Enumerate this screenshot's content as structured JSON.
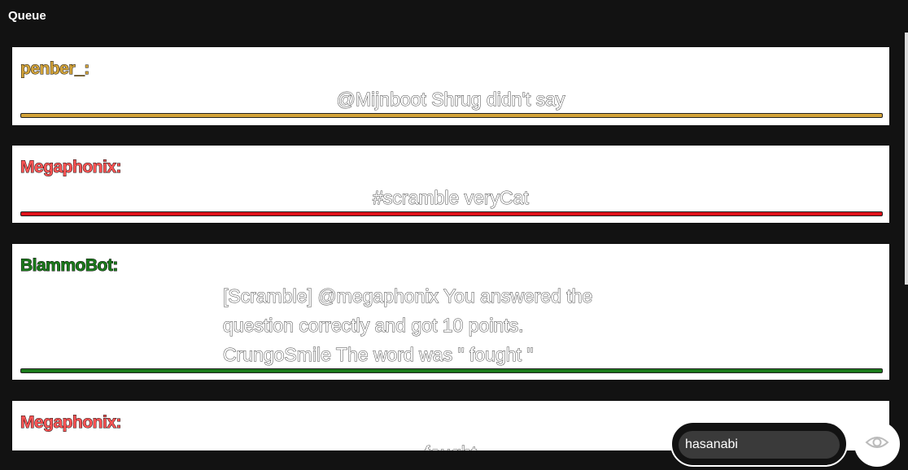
{
  "header": {
    "title": "Queue"
  },
  "queue": [
    {
      "user": "penber_:",
      "color": "#d4a43a",
      "lines": [
        "@Mijnboot Shrug didn't say"
      ]
    },
    {
      "user": "Megaphonix:",
      "color": "#ff5555",
      "bar_color": "#e0111a",
      "lines": [
        "#scramble veryCat"
      ]
    },
    {
      "user": "BlammoBot:",
      "color": "#1a7a1a",
      "lines": [
        "[Scramble] @megaphonix You answered the",
        "question correctly and got 10 points.",
        "CrungoSmile The word was \" fought \""
      ]
    },
    {
      "user": "Megaphonix:",
      "color": "#ff5555",
      "lines": [
        "fought"
      ]
    }
  ],
  "search": {
    "value": "hasanabi",
    "placeholder": ""
  },
  "icons": {
    "toggle": "eye-icon"
  }
}
